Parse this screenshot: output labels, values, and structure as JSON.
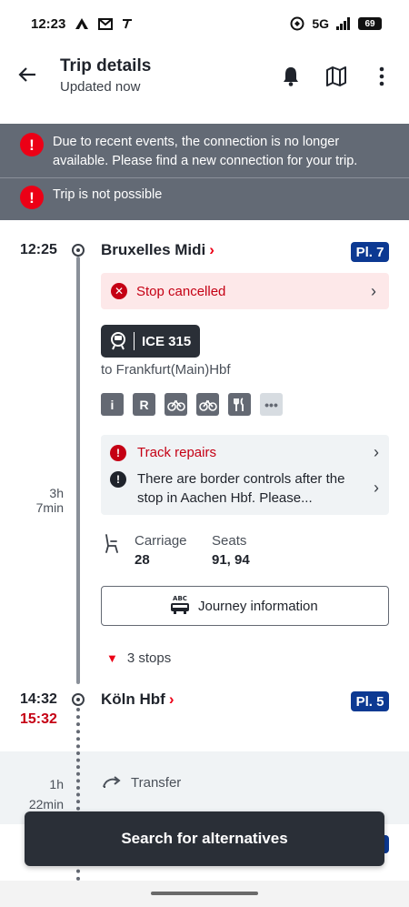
{
  "status_bar": {
    "time": "12:23",
    "network": "5G",
    "battery": "69"
  },
  "app_bar": {
    "title": "Trip details",
    "subtitle": "Updated now"
  },
  "alerts": [
    {
      "text": "Due to recent events, the connection is no longer available. Please find a new connection for your trip."
    },
    {
      "text": "Trip is not possible"
    }
  ],
  "departure": {
    "time": "12:25",
    "station": "Bruxelles Midi",
    "platform": "Pl. 7",
    "status": "Stop cancelled"
  },
  "train": {
    "name": "ICE 315",
    "destination": "to Frankfurt(Main)Hbf",
    "amenities": [
      "info-icon",
      "reservation-icon",
      "bike-icon",
      "bike-icon",
      "restaurant-icon",
      "more-icon"
    ],
    "reservation_letter": "R",
    "info_letter": "i"
  },
  "messages": [
    {
      "text": "Track repairs",
      "color": "#c50014"
    },
    {
      "text": "There are border controls after the stop in Aachen Hbf. Please...",
      "color": "#1f232b"
    }
  ],
  "duration": {
    "hours": "3h",
    "minutes": "7min"
  },
  "seating": {
    "carriage_label": "Carriage",
    "carriage_value": "28",
    "seats_label": "Seats",
    "seats_value": "91, 94"
  },
  "journey_info": {
    "label": "Journey information",
    "icon_text": "ABC"
  },
  "stops": {
    "label": "3 stops"
  },
  "arrival": {
    "time": "14:32",
    "delay_time": "15:32",
    "station": "Köln Hbf",
    "platform": "Pl. 5"
  },
  "transfer": {
    "hours": "1h",
    "minutes": "22min",
    "label": "Transfer"
  },
  "cta": {
    "label": "Search for alternatives"
  },
  "colors": {
    "accent_red": "#ec0016",
    "platform_blue": "#0c3992",
    "dark": "#2a2f37",
    "alert_gray": "#636a75"
  }
}
